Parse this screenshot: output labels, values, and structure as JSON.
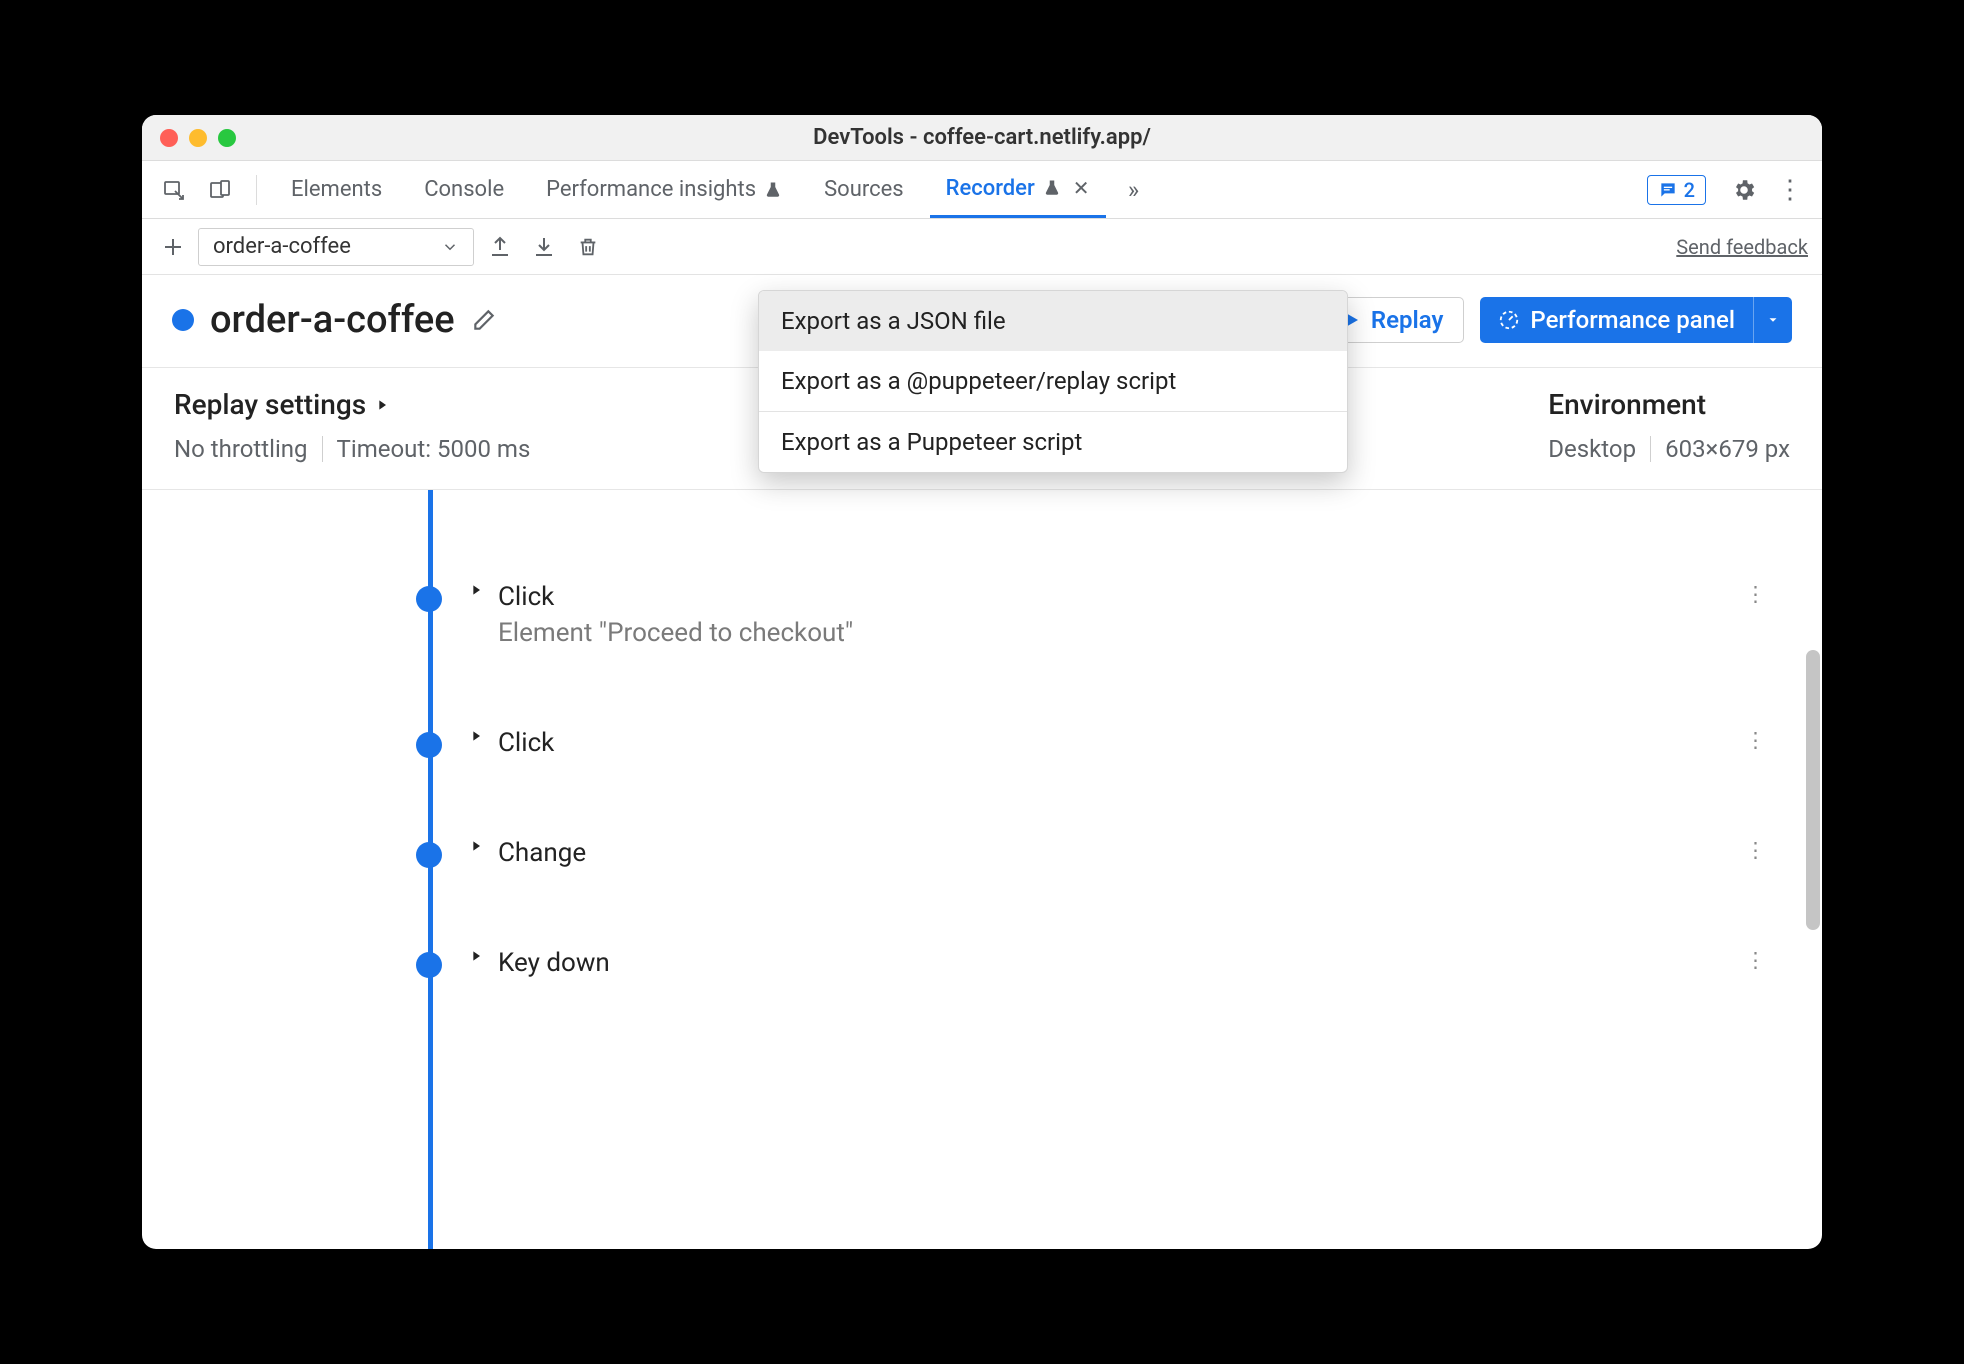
{
  "window": {
    "title": "DevTools - coffee-cart.netlify.app/"
  },
  "tabs": {
    "elements": "Elements",
    "console": "Console",
    "perf_insights": "Performance insights",
    "sources": "Sources",
    "recorder": "Recorder"
  },
  "issues_count": "2",
  "toolbar": {
    "recording_selected": "order-a-coffee",
    "send_feedback": "Send feedback"
  },
  "export_menu": {
    "json": "Export as a JSON file",
    "puppeteer_replay": "Export as a @puppeteer/replay script",
    "puppeteer": "Export as a Puppeteer script"
  },
  "recording": {
    "name": "order-a-coffee",
    "replay_label": "Replay",
    "perf_panel_label": "Performance panel"
  },
  "replay_settings": {
    "title": "Replay settings",
    "throttling": "No throttling",
    "timeout": "Timeout: 5000 ms"
  },
  "environment": {
    "title": "Environment",
    "device": "Desktop",
    "dimensions": "603×679 px"
  },
  "steps": [
    {
      "name": "Click",
      "detail": "Element \"Proceed to checkout\""
    },
    {
      "name": "Click",
      "detail": ""
    },
    {
      "name": "Change",
      "detail": ""
    },
    {
      "name": "Key down",
      "detail": ""
    }
  ]
}
